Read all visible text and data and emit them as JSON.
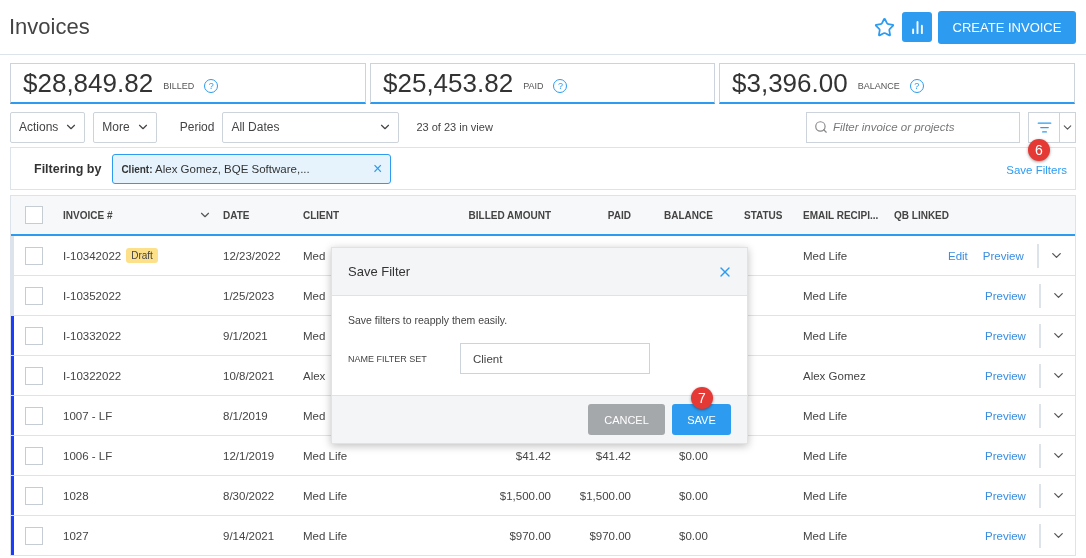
{
  "header": {
    "title": "Invoices",
    "create_button": "CREATE INVOICE"
  },
  "summary": [
    {
      "amount": "$28,849.82",
      "label": "BILLED",
      "help": "?"
    },
    {
      "amount": "$25,453.82",
      "label": "PAID",
      "help": "?"
    },
    {
      "amount": "$3,396.00",
      "label": "BALANCE",
      "help": "?"
    }
  ],
  "toolbar": {
    "actions": "Actions",
    "more": "More",
    "period_label": "Period",
    "period": "All Dates",
    "count": "23 of 23 in view",
    "search_placeholder": "Filter invoice or projects",
    "filter_callout": "6"
  },
  "filter_bar": {
    "label": "Filtering by",
    "chip": "**Client:** Alex Gomez, BQE Software,...",
    "chip_close": "×",
    "save_link": "Save Filters"
  },
  "table": {
    "header_checked": false,
    "columns": [
      "INVOICE #",
      "DATE",
      "CLIENT",
      "BILLED AMOUNT",
      "PAID",
      "BALANCE",
      "STATUS",
      "EMAIL RECIPI...",
      "QB LINKED"
    ],
    "rows": [
      {
        "invoice": "I-10342022",
        "badge": "Draft",
        "date": "12/23/2022",
        "client": "Med",
        "email": "Med Life",
        "edit": "Edit",
        "preview": "Preview",
        "marked": false,
        "checked": false
      },
      {
        "invoice": "I-10352022",
        "date": "1/25/2023",
        "client": "Med",
        "email": "Med Life",
        "preview": "Preview",
        "marked": false,
        "checked": false
      },
      {
        "invoice": "I-10332022",
        "date": "9/1/2021",
        "client": "Med",
        "email": "Med Life",
        "preview": "Preview",
        "marked": true,
        "checked": false
      },
      {
        "invoice": "I-10322022",
        "date": "10/8/2021",
        "client": "Alex",
        "email": "Alex Gomez",
        "preview": "Preview",
        "marked": true,
        "checked": false
      },
      {
        "invoice": "1007 - LF",
        "date": "8/1/2019",
        "client": "Med",
        "email": "Med Life",
        "preview": "Preview",
        "marked": true,
        "checked": false
      },
      {
        "invoice": "1006 - LF",
        "date": "12/1/2019",
        "client": "Med Life",
        "billed": "$41.42",
        "paid": "$41.42",
        "balance": "$0.00",
        "email": "Med Life",
        "preview": "Preview",
        "marked": true,
        "checked": false
      },
      {
        "invoice": "1028",
        "date": "8/30/2022",
        "client": "Med Life",
        "billed": "$1,500.00",
        "paid": "$1,500.00",
        "balance": "$0.00",
        "email": "Med Life",
        "preview": "Preview",
        "marked": true,
        "checked": false
      },
      {
        "invoice": "1027",
        "date": "9/14/2021",
        "client": "Med Life",
        "billed": "$970.00",
        "paid": "$970.00",
        "balance": "$0.00",
        "email": "Med Life",
        "preview": "Preview",
        "marked": true,
        "checked": false
      }
    ]
  },
  "dialog": {
    "title": "Save Filter",
    "message": "Save filters to reapply them easily.",
    "field_label": "NAME FILTER SET",
    "field_value": "Client",
    "cancel": "CANCEL",
    "save": "SAVE",
    "save_callout": "7"
  }
}
